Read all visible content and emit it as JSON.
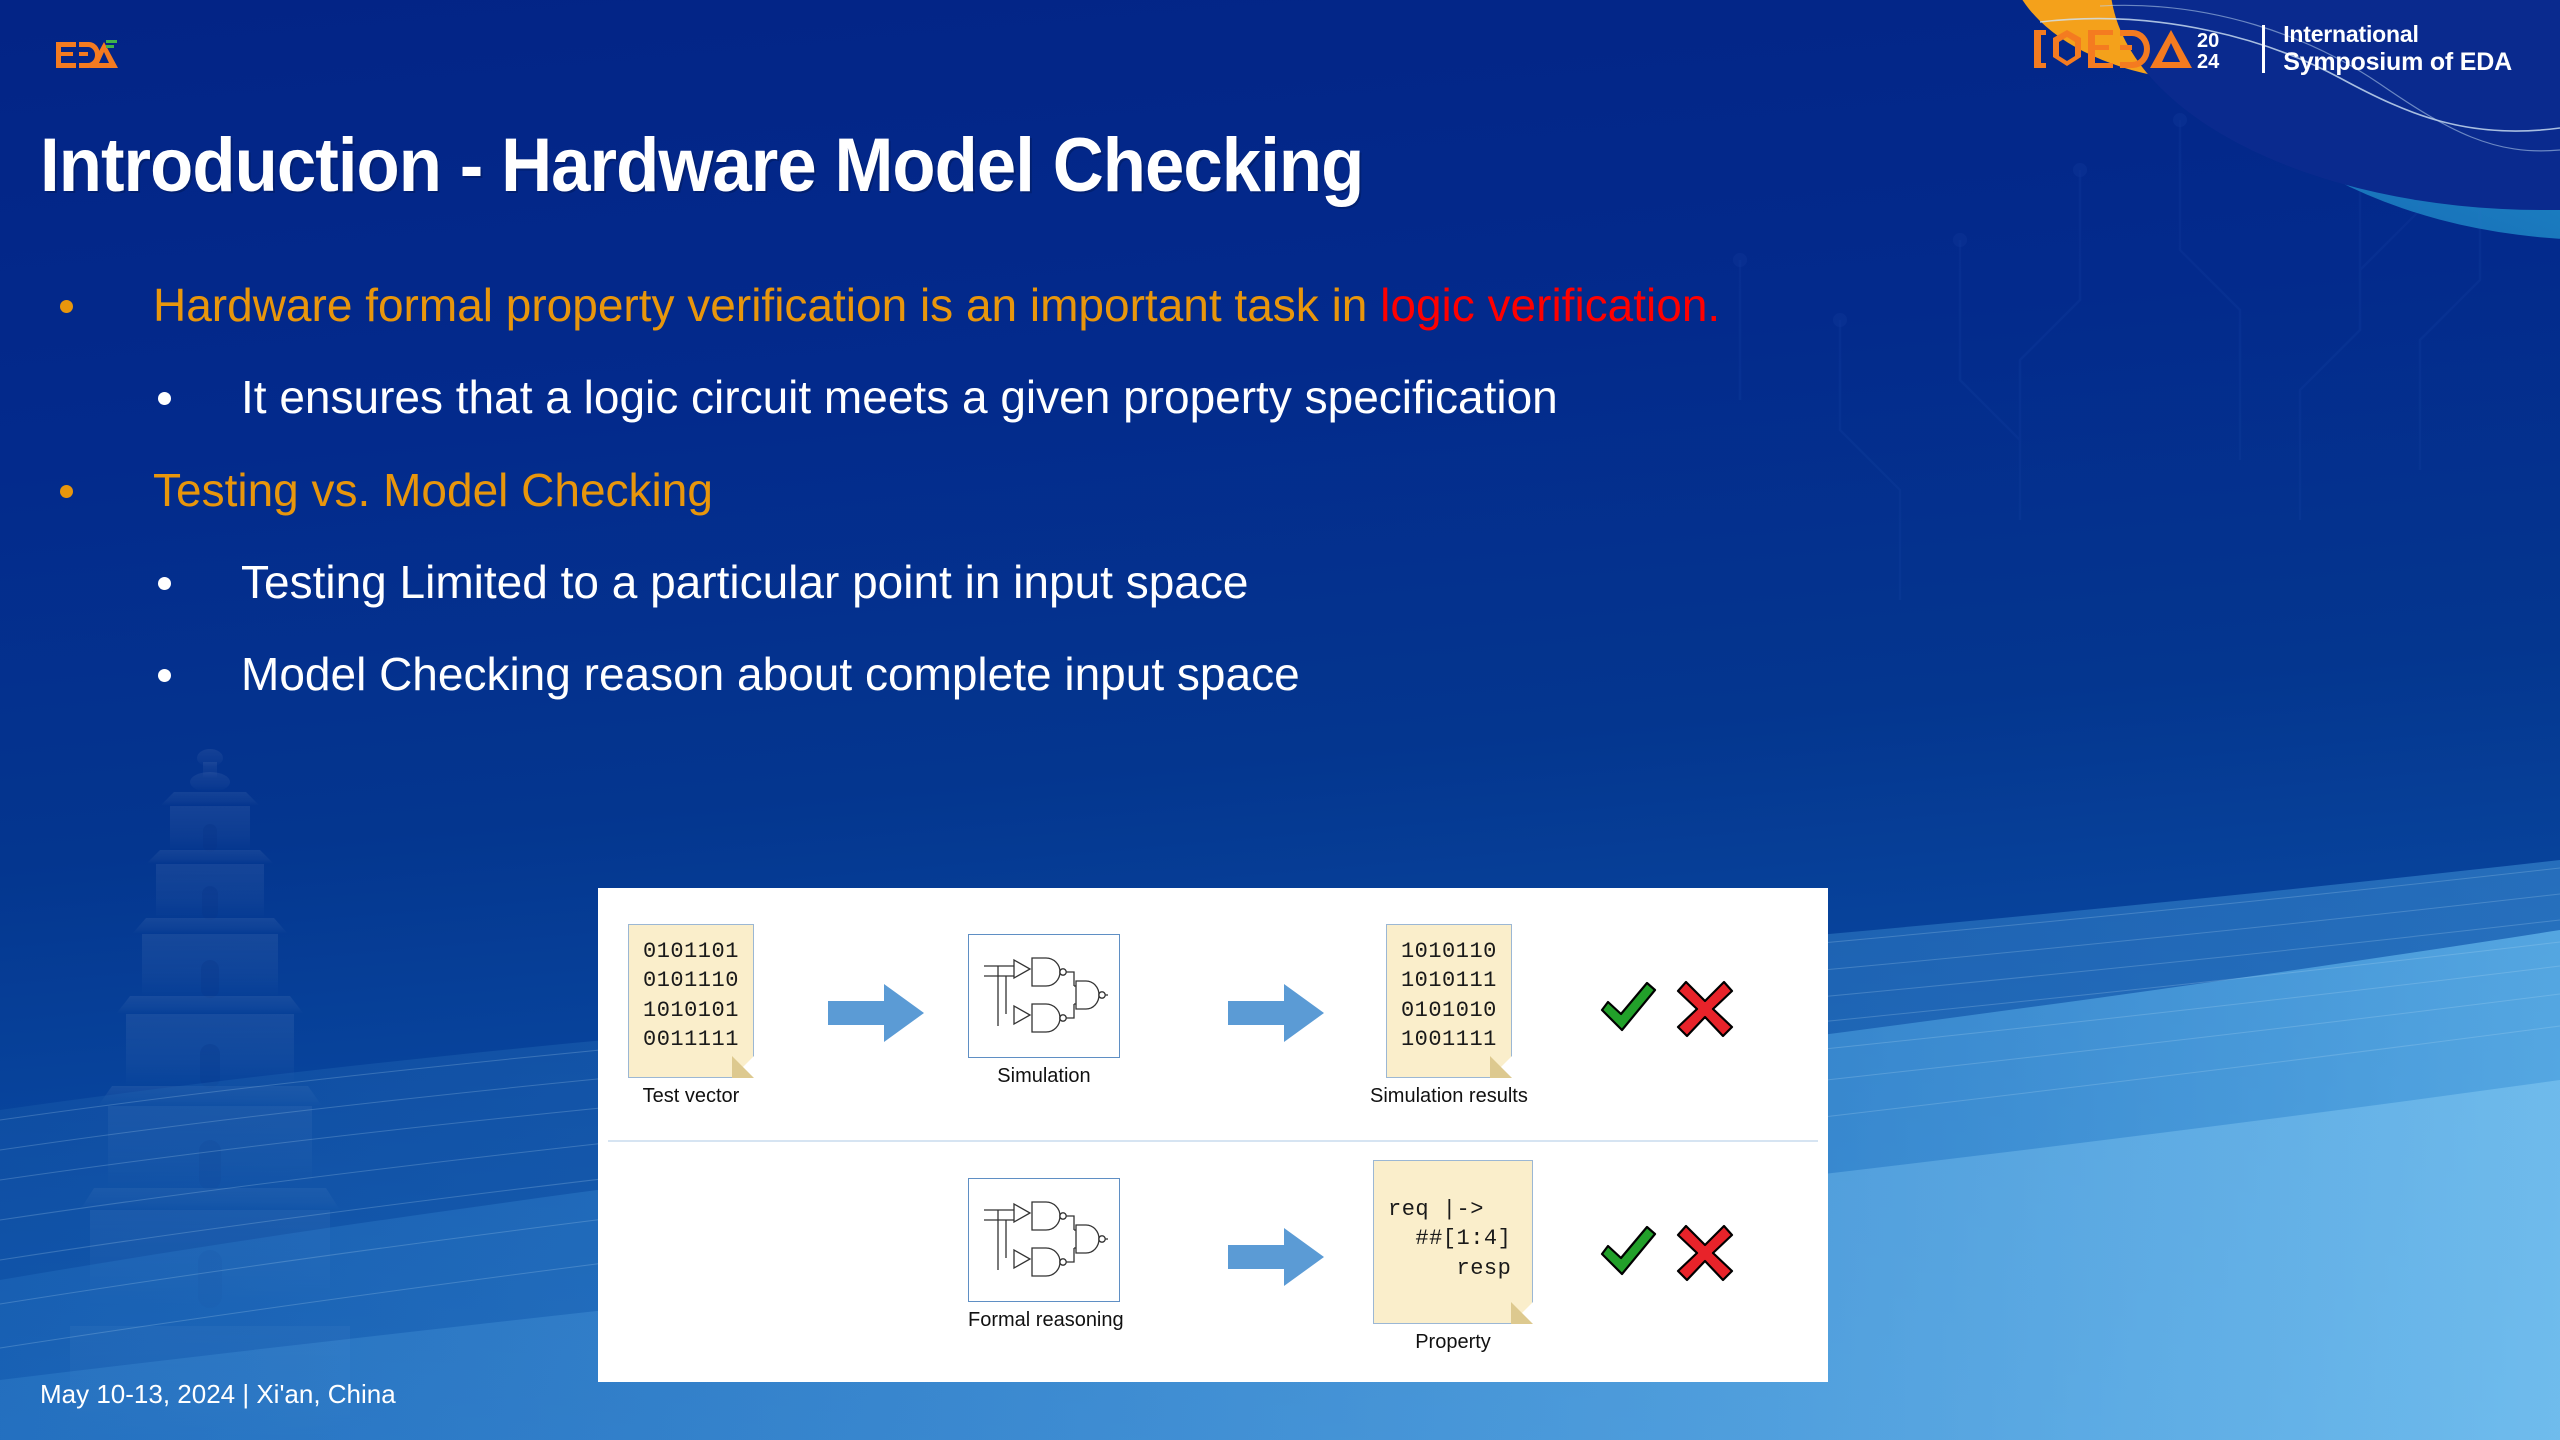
{
  "brand": {
    "eda_logo": "EDA",
    "iseda_logo": "ISEDA",
    "iseda_year_top": "20",
    "iseda_year_bottom": "24",
    "iseda_line1": "International",
    "iseda_line2": "Symposium of EDA",
    "accent_orange": "#f47b20",
    "accent_green": "#3fb449",
    "accent_teal": "#1aa9d6",
    "slide_blue": "#032a8c"
  },
  "title": "Introduction - Hardware Model Checking",
  "bullets": [
    {
      "level": 1,
      "text_plain": "Hardware formal property verification is an important task in logic verification.",
      "text": "Hardware formal property verification is an important task in ",
      "highlight": "logic verification.",
      "color": "#e8960c",
      "highlight_color": "#ff0000"
    },
    {
      "level": 2,
      "text": "It ensures that a logic circuit meets a given property specification",
      "color": "#ffffff"
    },
    {
      "level": 1,
      "text": "Testing vs. Model Checking",
      "color": "#e8960c"
    },
    {
      "level": 2,
      "text": "Testing Limited to a particular point in input space",
      "color": "#ffffff"
    },
    {
      "level": 2,
      "text": "Model Checking reason about complete input space",
      "color": "#ffffff"
    }
  ],
  "diagram": {
    "row_testing": {
      "test_vector": {
        "caption": "Test vector",
        "lines": "0101101\n0101110\n1010101\n0011111"
      },
      "simulation": {
        "caption": "Simulation"
      },
      "results": {
        "caption": "Simulation results",
        "lines": "1010110\n1010111\n0101010\n1001111"
      },
      "verdict_pass": "check-mark",
      "verdict_fail": "cross-mark"
    },
    "row_model_checking": {
      "formal_reasoning": {
        "caption": "Formal reasoning"
      },
      "property": {
        "caption": "Property",
        "lines": "req |->\n  ##[1:4]\n     resp"
      },
      "verdict_pass": "check-mark",
      "verdict_fail": "cross-mark"
    }
  },
  "footer": "May 10-13, 2024 | Xi'an, China"
}
